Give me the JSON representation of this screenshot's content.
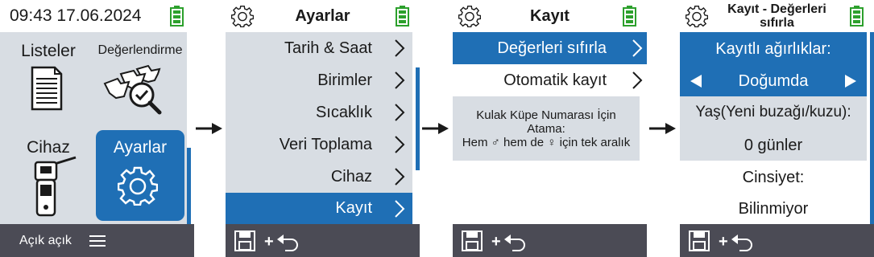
{
  "screen1": {
    "time_date": "09:43 17.06.2024",
    "tiles": [
      "Listeler",
      "Değerlendirme",
      "Cihaz",
      "Ayarlar"
    ],
    "footer_text": "Açık açık",
    "icons": [
      "battery-icon",
      "document-list-icon",
      "cows-magnifier-icon",
      "reader-device-icon",
      "settings-gear-icon",
      "hamburger-menu-icon"
    ]
  },
  "screen2": {
    "title": "Ayarlar",
    "items": [
      "Tarih & Saat",
      "Birimler",
      "Sıcaklık",
      "Veri Toplama",
      "Cihaz",
      "Kayıt"
    ],
    "selected": "Kayıt"
  },
  "screen3": {
    "title": "Kayıt",
    "items": [
      "Değerleri sıfırla",
      "Otomatik kayıt"
    ],
    "selected": "Değerleri sıfırla",
    "info_text": "Kulak Küpe Numarası İçin Atama:\nHem ♂ hem de ♀ için tek aralık"
  },
  "screen4": {
    "title": "Kayıt - Değerleri sıfırla",
    "selected_header": "Kayıtlı ağırlıklar:",
    "selector_value": "Doğumda",
    "age_label": "Yaş(Yeni buzağı/kuzu):",
    "age_value": "0 günler",
    "sex_label": "Cinsiyet:",
    "sex_value": "Bilinmiyor"
  },
  "footer_plus": "+",
  "colors": {
    "accent": "#1f6fb5",
    "panel": "#d8dde3",
    "footer": "#4b4b55",
    "battery": "#2ca02c"
  }
}
